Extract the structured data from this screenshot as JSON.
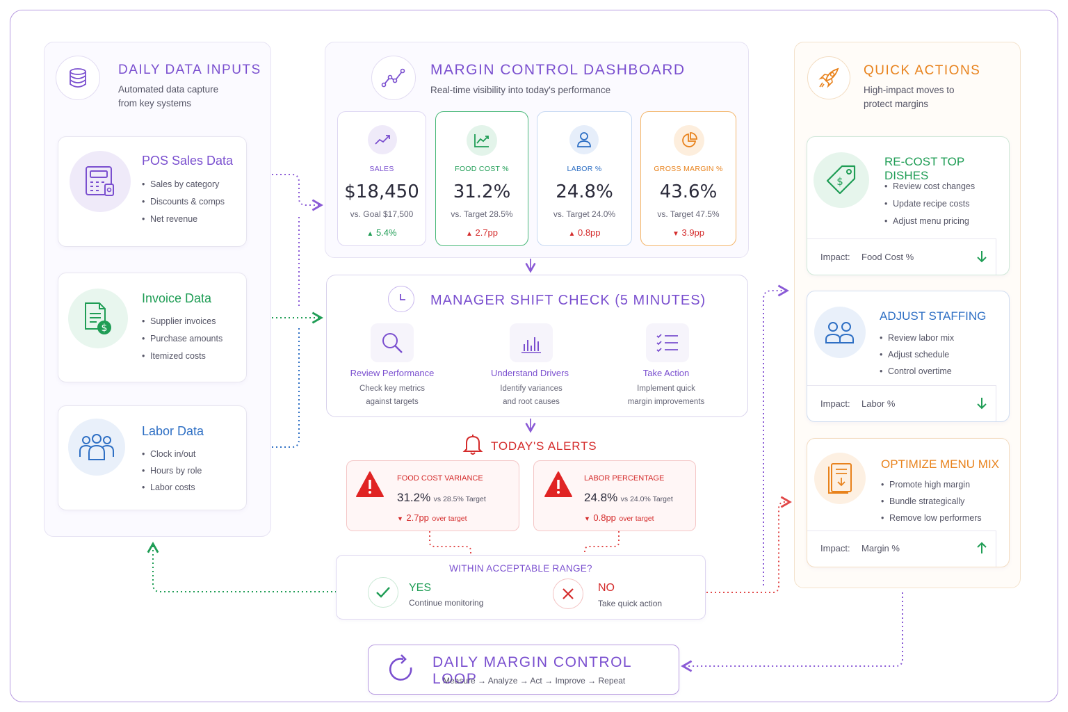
{
  "colors": {
    "purple": "#7a4fcf",
    "green": "#1f9d55",
    "blue": "#2e6fc4",
    "orange": "#e8821c",
    "red": "#d42b2b"
  },
  "inputs": {
    "title": "DAILY DATA INPUTS",
    "subtitle_1": "Automated data capture",
    "subtitle_2": "from key systems",
    "icon": "database-icon",
    "pos": {
      "title": "POS Sales Data",
      "icon": "register-icon",
      "items": [
        "Sales by category",
        "Discounts & comps",
        "Net revenue"
      ]
    },
    "invoice": {
      "title": "Invoice Data",
      "icon": "invoice-icon",
      "items": [
        "Supplier invoices",
        "Purchase amounts",
        "Itemized costs"
      ]
    },
    "labor": {
      "title": "Labor Data",
      "icon": "team-icon",
      "items": [
        "Clock in/out",
        "Hours by role",
        "Labor costs"
      ]
    }
  },
  "dashboard": {
    "title": "MARGIN CONTROL DASHBOARD",
    "subtitle": "Real-time visibility into today's performance",
    "icon": "trend-chart-icon",
    "kpis": [
      {
        "label": "SALES",
        "value": "$18,450",
        "sub": "vs. Goal $17,500",
        "delta": "5.4%",
        "direction": "up",
        "icon": "trend-line-icon"
      },
      {
        "label": "FOOD COST %",
        "value": "31.2%",
        "sub": "vs. Target 28.5%",
        "delta": "2.7pp",
        "direction": "up",
        "icon": "line-chart-icon"
      },
      {
        "label": "LABOR %",
        "value": "24.8%",
        "sub": "vs. Target 24.0%",
        "delta": "0.8pp",
        "direction": "up",
        "icon": "person-icon"
      },
      {
        "label": "GROSS MARGIN %",
        "value": "43.6%",
        "sub": "vs. Target 47.5%",
        "delta": "3.9pp",
        "direction": "down",
        "icon": "pie-chart-icon"
      }
    ]
  },
  "shift_check": {
    "title": "MANAGER SHIFT CHECK (5 MINUTES)",
    "icon": "clock-icon",
    "steps": [
      {
        "title": "Review Performance",
        "desc_1": "Check key metrics",
        "desc_2": "against targets",
        "icon": "magnifier-icon"
      },
      {
        "title": "Understand Drivers",
        "desc_1": "Identify variances",
        "desc_2": "and root causes",
        "icon": "bar-chart-icon"
      },
      {
        "title": "Take Action",
        "desc_1": "Implement quick",
        "desc_2": "margin improvements",
        "icon": "checklist-icon"
      }
    ]
  },
  "alerts": {
    "title": "TODAY'S ALERTS",
    "icon": "bell-icon",
    "items": [
      {
        "label": "FOOD COST VARIANCE",
        "value": "31.2%",
        "target": "vs 28.5% Target",
        "delta": "2.7pp",
        "note": "over target"
      },
      {
        "label": "LABOR PERCENTAGE",
        "value": "24.8%",
        "target": "vs 24.0% Target",
        "delta": "0.8pp",
        "note": "over target"
      }
    ]
  },
  "decision": {
    "question": "WITHIN ACCEPTABLE RANGE?",
    "yes_label": "YES",
    "yes_desc": "Continue monitoring",
    "no_label": "NO",
    "no_desc": "Take quick action"
  },
  "loop": {
    "title": "DAILY MARGIN CONTROL LOOP",
    "steps": [
      "Measure",
      "Analyze",
      "Act",
      "Improve",
      "Repeat"
    ],
    "arrow": "→"
  },
  "actions": {
    "title": "QUICK ACTIONS",
    "subtitle_1": "High-impact moves to",
    "subtitle_2": "protect margins",
    "icon": "rocket-icon",
    "impact_label": "Impact:",
    "items": [
      {
        "title": "RE-COST TOP DISHES",
        "items": [
          "Review cost changes",
          "Update recipe costs",
          "Adjust menu pricing"
        ],
        "impact": "Food Cost %",
        "direction": "down",
        "icon": "price-tag-icon"
      },
      {
        "title": "ADJUST STAFFING",
        "items": [
          "Review labor mix",
          "Adjust schedule",
          "Control overtime"
        ],
        "impact": "Labor %",
        "direction": "down",
        "icon": "staff-icon"
      },
      {
        "title": "OPTIMIZE MENU MIX",
        "items": [
          "Promote high margin",
          "Bundle strategically",
          "Remove low performers"
        ],
        "impact": "Margin %",
        "direction": "up",
        "icon": "menu-icon"
      }
    ]
  }
}
